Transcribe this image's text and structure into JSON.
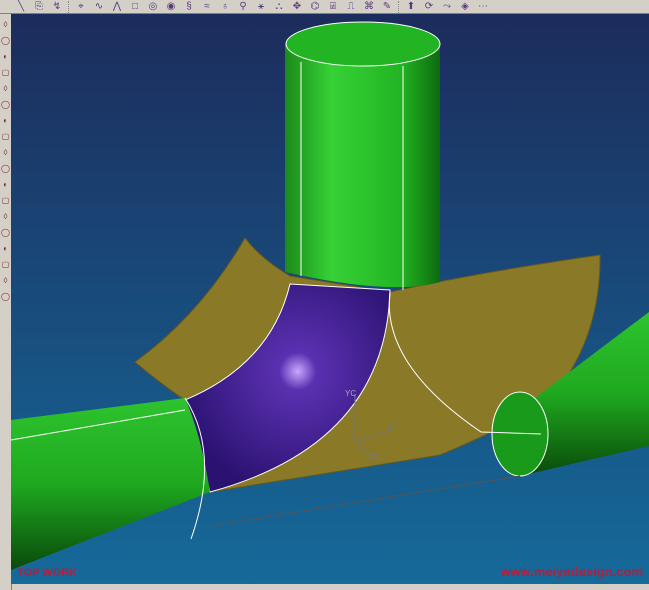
{
  "toolbar": {
    "icons": [
      "line-icon",
      "new-sketch-icon",
      "curve-icon",
      "point-icon",
      "spline-icon",
      "polyline-icon",
      "rectangle-icon",
      "polygon-icon",
      "circle-icon",
      "helix-icon",
      "law-curve-icon",
      "offset-icon",
      "project-icon",
      "intersect-icon",
      "section-icon",
      "extract-icon",
      "bridge-icon",
      "combine-icon",
      "wrap-icon",
      "join-icon",
      "text-icon",
      "extrude-icon",
      "revolve-icon",
      "sweep-icon",
      "surface-icon",
      "more-icon"
    ]
  },
  "left_toolbar": {
    "icons": [
      "view-icon",
      "rotate-icon",
      "pan-icon",
      "zoom-icon",
      "fit-icon",
      "shade-icon",
      "wireframe-icon",
      "layer-icon",
      "snap-icon",
      "measure-icon",
      "select-icon",
      "filter-icon",
      "refresh-icon",
      "section-icon",
      "light-icon",
      "hide-icon",
      "show-icon",
      "undo-icon"
    ]
  },
  "viewport": {
    "view_label": "TOP WORK",
    "watermark": "www.meiyadesign.com",
    "axes": {
      "x": "XC",
      "y": "YC",
      "z": "ZC"
    },
    "colors": {
      "background_top": "#1c2c5c",
      "background_bottom": "#156a9a",
      "pipe": "#22b422",
      "elbow": "#3a1a82",
      "surface": "#8a7a28",
      "label": "#b02040"
    }
  }
}
